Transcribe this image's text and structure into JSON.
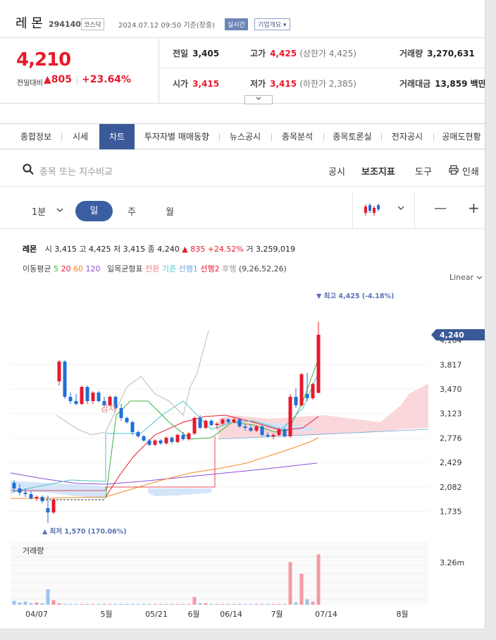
{
  "header": {
    "name": "레 몬",
    "code": "294140",
    "market": "코스닥",
    "datetime": "2024.07.12 09:50 기준(장중)",
    "realtime_badge": "실시간",
    "company_btn": "기업개요 ▾"
  },
  "price": {
    "current": "4,210",
    "change_label": "전일대비",
    "change": "▲805",
    "change_pct": "+23.64%",
    "prev_label": "전일",
    "prev": "3,405",
    "high_label": "고가",
    "high": "4,425",
    "upper_limit": "(상한가 4,425)",
    "volume_label": "거래량",
    "volume": "3,270,631",
    "open_label": "시가",
    "open": "3,415",
    "low_label": "저가",
    "low": "3,415",
    "lower_limit": "(하한가 2,385)",
    "amount_label": "거래대금",
    "amount": "13,859 백만",
    "expand_icon": "chevron-down-icon"
  },
  "tabs": [
    {
      "label": "종합정보"
    },
    {
      "label": "시세"
    },
    {
      "label": "차트"
    },
    {
      "label": "투자자별 매매동향"
    },
    {
      "label": "뉴스공시"
    },
    {
      "label": "종목분석"
    },
    {
      "label": "종목토론실"
    },
    {
      "label": "전자공시"
    },
    {
      "label": "공매도현황"
    }
  ],
  "active_tab": "차트",
  "search": {
    "placeholder": "종목 또는 지수비교",
    "tools": [
      "공시",
      "보조지표",
      "도구",
      "인쇄"
    ]
  },
  "period": {
    "minute": "1분",
    "day": "일",
    "week": "주",
    "month": "월",
    "zoom_out": "—",
    "zoom_in": "+"
  },
  "chart_info": {
    "name": "레몬",
    "open_label": "시",
    "open": "3,415",
    "high_label": "고",
    "high": "4,425",
    "low_label": "저",
    "low": "3,415",
    "close_label": "종",
    "close": "4,240",
    "change": "▲ 835",
    "change_pct": "+24.52%",
    "vol_label": "거",
    "volume": "3,259,019",
    "ma_label": "이동평균",
    "ma5": "5",
    "ma20": "20",
    "ma60": "60",
    "ma120": "120",
    "ichimoku_label": "일목균형표",
    "ich_conv": "전환",
    "ich_base": "기준",
    "ich_lead1": "선행1",
    "ich_lead2": "선행2",
    "ich_lag": "후행",
    "ich_params": "(9,26,52,26)",
    "scale": "Linear"
  },
  "colors": {
    "up": "#e8192c",
    "down": "#1e6fd9",
    "ma5": "#3cb043",
    "ma20": "#e8192c",
    "ma60": "#f08a24",
    "ma120": "#8a4fd6",
    "accent": "#3b5998"
  },
  "chart_data": {
    "type": "candlestick",
    "y_ticks": [
      "3,817",
      "3,470",
      "3,123",
      "2,776",
      "2,429",
      "2,082",
      "1,735"
    ],
    "y_tick_values": [
      3817,
      3470,
      3123,
      2776,
      2429,
      2082,
      1735
    ],
    "current_label": "4,240",
    "partial_tick": "4,164",
    "max_label": "▼ 최고 4,425 (-4.18%)",
    "min_label": "▲ 최저 1,570 (170.06%)",
    "annotation": "감자",
    "volume_title": "거래량",
    "volume_tick": "3.26m",
    "x_labels": [
      "04/07",
      "5월",
      "05/21",
      "6월",
      "06/14",
      "7월",
      "07/14",
      "8월"
    ],
    "candles": [
      {
        "o": 2140,
        "h": 2180,
        "l": 2010,
        "c": 2060
      },
      {
        "o": 2060,
        "h": 2120,
        "l": 1960,
        "c": 2000
      },
      {
        "o": 2000,
        "h": 2060,
        "l": 1940,
        "c": 1980
      },
      {
        "o": 1980,
        "h": 2020,
        "l": 1900,
        "c": 1920
      },
      {
        "o": 1920,
        "h": 1960,
        "l": 1880,
        "c": 1940
      },
      {
        "o": 1940,
        "h": 1960,
        "l": 1850,
        "c": 1880
      },
      {
        "o": 1780,
        "h": 1960,
        "l": 1570,
        "c": 1720
      },
      {
        "o": 1720,
        "h": 1920,
        "l": 1700,
        "c": 1900
      },
      {
        "o": 3580,
        "h": 3880,
        "l": 3520,
        "c": 3860
      },
      {
        "o": 3860,
        "h": 3880,
        "l": 3330,
        "c": 3360
      },
      {
        "o": 3360,
        "h": 3420,
        "l": 3260,
        "c": 3300
      },
      {
        "o": 3300,
        "h": 3400,
        "l": 3240,
        "c": 3260
      },
      {
        "o": 3260,
        "h": 3520,
        "l": 3240,
        "c": 3500
      },
      {
        "o": 3500,
        "h": 3520,
        "l": 3260,
        "c": 3300
      },
      {
        "o": 3300,
        "h": 3440,
        "l": 3260,
        "c": 3420
      },
      {
        "o": 3420,
        "h": 3440,
        "l": 3280,
        "c": 3300
      },
      {
        "o": 3300,
        "h": 3360,
        "l": 3200,
        "c": 3240
      },
      {
        "o": 3240,
        "h": 3380,
        "l": 3220,
        "c": 3360
      },
      {
        "o": 3360,
        "h": 3380,
        "l": 3180,
        "c": 3200
      },
      {
        "o": 3200,
        "h": 3260,
        "l": 3020,
        "c": 3060
      },
      {
        "o": 3060,
        "h": 3080,
        "l": 2980,
        "c": 3000
      },
      {
        "o": 3000,
        "h": 3020,
        "l": 2820,
        "c": 2860
      },
      {
        "o": 2860,
        "h": 2880,
        "l": 2780,
        "c": 2800
      },
      {
        "o": 2800,
        "h": 2820,
        "l": 2720,
        "c": 2740
      },
      {
        "o": 2740,
        "h": 2760,
        "l": 2660,
        "c": 2680
      },
      {
        "o": 2680,
        "h": 2760,
        "l": 2660,
        "c": 2740
      },
      {
        "o": 2740,
        "h": 2760,
        "l": 2680,
        "c": 2700
      },
      {
        "o": 2700,
        "h": 2800,
        "l": 2680,
        "c": 2780
      },
      {
        "o": 2780,
        "h": 2800,
        "l": 2700,
        "c": 2720
      },
      {
        "o": 2720,
        "h": 2840,
        "l": 2700,
        "c": 2820
      },
      {
        "o": 2820,
        "h": 2860,
        "l": 2740,
        "c": 2760
      },
      {
        "o": 2760,
        "h": 2860,
        "l": 2740,
        "c": 2840
      },
      {
        "o": 2840,
        "h": 3080,
        "l": 2820,
        "c": 3060
      },
      {
        "o": 3060,
        "h": 3100,
        "l": 2900,
        "c": 2920
      },
      {
        "o": 2920,
        "h": 3040,
        "l": 2900,
        "c": 3020
      },
      {
        "o": 3020,
        "h": 3040,
        "l": 2940,
        "c": 2960
      },
      {
        "o": 2960,
        "h": 3000,
        "l": 2900,
        "c": 2980
      },
      {
        "o": 2980,
        "h": 3060,
        "l": 2960,
        "c": 3040
      },
      {
        "o": 3040,
        "h": 3060,
        "l": 2980,
        "c": 3000
      },
      {
        "o": 3000,
        "h": 3060,
        "l": 2980,
        "c": 3040
      },
      {
        "o": 3040,
        "h": 3060,
        "l": 2920,
        "c": 2940
      },
      {
        "o": 2940,
        "h": 2980,
        "l": 2880,
        "c": 2920
      },
      {
        "o": 2920,
        "h": 2960,
        "l": 2860,
        "c": 2880
      },
      {
        "o": 2880,
        "h": 2960,
        "l": 2860,
        "c": 2940
      },
      {
        "o": 2940,
        "h": 2960,
        "l": 2800,
        "c": 2820
      },
      {
        "o": 2820,
        "h": 2860,
        "l": 2780,
        "c": 2800
      },
      {
        "o": 2800,
        "h": 2840,
        "l": 2760,
        "c": 2820
      },
      {
        "o": 2820,
        "h": 2920,
        "l": 2800,
        "c": 2900
      },
      {
        "o": 2900,
        "h": 2920,
        "l": 2780,
        "c": 2800
      },
      {
        "o": 2800,
        "h": 3400,
        "l": 2780,
        "c": 3360
      },
      {
        "o": 3360,
        "h": 3480,
        "l": 3200,
        "c": 3240
      },
      {
        "o": 3240,
        "h": 3700,
        "l": 3220,
        "c": 3680
      },
      {
        "o": 3400,
        "h": 3700,
        "l": 3300,
        "c": 3340
      },
      {
        "o": 3340,
        "h": 3560,
        "l": 3320,
        "c": 3540
      },
      {
        "o": 3415,
        "h": 4425,
        "l": 3415,
        "c": 4240
      }
    ],
    "volumes": [
      0.05,
      0.03,
      0.04,
      0.02,
      0.03,
      0.02,
      0.2,
      0.06,
      0.02,
      0.01,
      0.01,
      0.01,
      0.01,
      0.01,
      0.01,
      0.01,
      0.01,
      0.01,
      0.01,
      0.01,
      0.01,
      0.01,
      0.01,
      0.01,
      0.01,
      0.01,
      0.01,
      0.01,
      0.01,
      0.01,
      0.01,
      0.01,
      0.1,
      0.02,
      0.02,
      0.01,
      0.01,
      0.01,
      0.01,
      0.01,
      0.01,
      0.01,
      0.01,
      0.01,
      0.01,
      0.01,
      0.01,
      0.01,
      0.01,
      0.55,
      0.03,
      0.4,
      0.07,
      0.04,
      0.65
    ]
  }
}
